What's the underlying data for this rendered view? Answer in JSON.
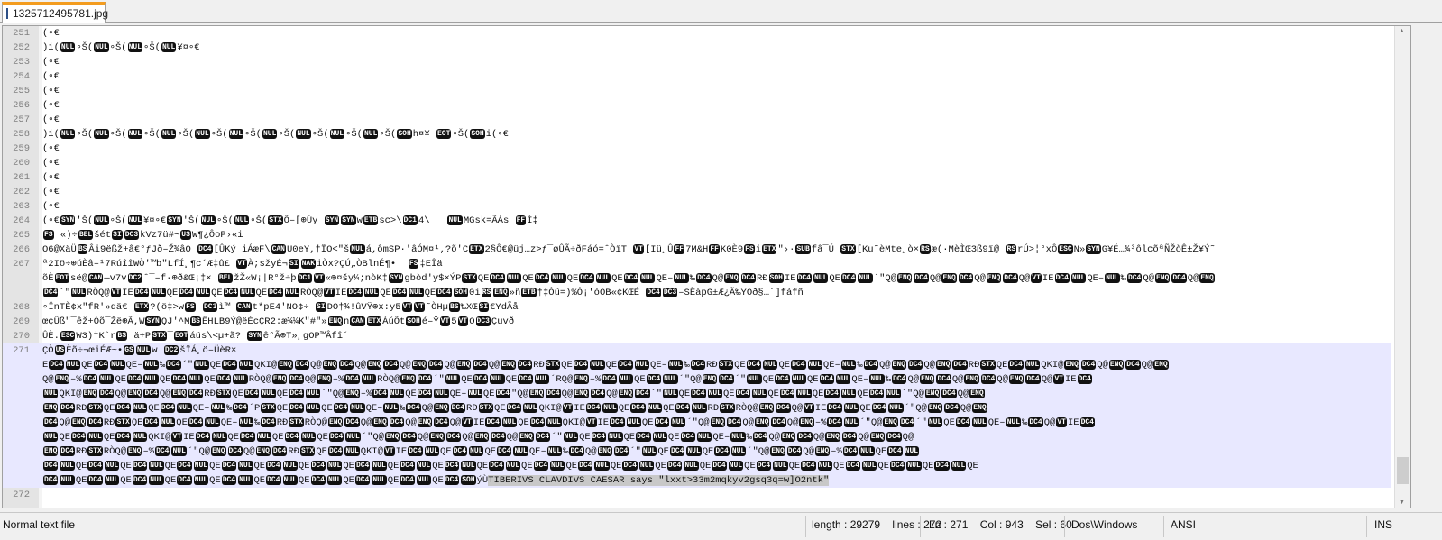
{
  "tab": {
    "filename": "1325712495781.jpg",
    "icon": "save-disk-icon"
  },
  "lines": [
    {
      "num": "251",
      "text": "(∘€"
    },
    {
      "num": "252",
      "text": ")i(«NUL»∘Š(«NUL»∘Š(«NUL»∘Š(«NUL»¥¤∘€"
    },
    {
      "num": "253",
      "text": "(∘€"
    },
    {
      "num": "254",
      "text": "(∘€"
    },
    {
      "num": "255",
      "text": "(∘€"
    },
    {
      "num": "256",
      "text": "(∘€"
    },
    {
      "num": "257",
      "text": "(∘€"
    },
    {
      "num": "258",
      "text": ")i(«NUL»∘Š(«NUL»∘Š(«NUL»∘Š(«NUL»∘Š(«NUL»∘Š(«NUL»∘Š(«NUL»∘Š(«NUL»∘Š(«NUL»∘Š(«NUL»∘Š(«SOH»h¤¥ «EOT»∘Š(«SOH»i(∘€"
    },
    {
      "num": "259",
      "text": "(∘€"
    },
    {
      "num": "260",
      "text": "(∘€"
    },
    {
      "num": "261",
      "text": "(∘€"
    },
    {
      "num": "262",
      "text": "(∘€"
    },
    {
      "num": "263",
      "text": "(∘€"
    },
    {
      "num": "264",
      "text": "(∘€«SYN»'Š(«NUL»∘Š(«NUL»¥¤∘€«SYN»'Š(«NUL»∘Š(«NUL»∘Š(«STX»Õ–[⊕Ùy «SYN»«SYN»w«ETB»sc>\\«DC1»4\\   «NUL»MGsk=ÃÁs «FF»Ì‡"
    },
    {
      "num": "265",
      "text": "«FS» «)÷«BEL»šét«SI»«DC3»kVz7ü#~«US»W¶¿ÔoP›«i"
    },
    {
      "num": "266",
      "text": "O6@XäÜ«BS»Âi9ëßž+â€°ƒJð–Ž¾âO «DC4»[ÛKý iÁæF\\«CAN»U0eY,†ÏO<\"š«NUL»á,ômSP·'âÓM¤¹,?õ'C«ETX»2§Ô€@üj…z>ƒ¯øÛÃ÷ðFáó=ˆÒïT «VT»[Iü¸Û«FF»7M&H«FF»K0È9«FS»i«ETX»\"›·«SUB»fâ¯Ú «STX»[Ku˜èMte¸ò×«RS»æ(·MèÌŒ3ß9ï@ «RS»rÚ>¦°xÔ«ESC»N»«SYN»G¥É…¾³ôlcõªÑŽòÊ±Ž¥Ý˜"
    },
    {
      "num": "267",
      "text": "ª2Iö÷⊕úÈâ–¹7RúîîWÒ'™b\"LfÍ¸¶c´Æ‡û£ «VT»À;sžyÉ¬«SI»«NAK»iÒx?ÇÚ„ÒBlnÉ¶•  «FS»‡EÎä\nõÈ«EOT»së@«CAN»—v7v«DC2»ˆ¯–f·⊕ð&Œ¡‡× «BEL»žŽ«W¡|R°ž÷þ«DC1»«VT»«⊕¤šy¼;nòK‡«SYN»gbòd'y$×ÝP«STX»QE«DC4»«NUL»QE«DC4»«NUL»QE«DC4»«NUL»QE«DC4»«NUL»QE–«NUL»‰«DC4»Q@«ENQ»«DC4»RÐ«SOH»IE«DC4»«NUL»QE«DC4»«NUL»´\"Q@«ENQ»«DC4»Q@«ENQ»«DC4»Q@«ENQ»«DC4»Q@«VT»IE«DC4»«NUL»QE–«NUL»‰«DC4»Q@«ENQ»«DC4»Q@«ENQ»\n«DC4»´\"«NUL»RÒQ@«VT»IE«DC4»«NUL»QE«DC4»«NUL»QE«DC4»«NUL»QE«DC4»«NUL»RÒQ@«VT»IE«DC4»«NUL»QE«DC4»«NUL»QE«DC4»«SOH»0i«RS»«ENQ»»ñ«ETB»†‡Ôü=)%Ô¡'óOB«¢KŒÉ «DC4»«DC3»–SÈàpG±Æ¿Ã‰ŸOð§…´]fáfñ"
    },
    {
      "num": "268",
      "text": "∘ÎnTÈ¢x\"fR'»dä€ «ETX»?(ö‡>w«FS» «DC3»ì™ «CAN»t*pE4'NO¢÷ «SI»DO†¾!ûVŸ⊕x:y5«VT»«VT»˜ÒHµ«BS»‰XŒ«SI»€YdÃå"
    },
    {
      "num": "269",
      "text": "œçÛß\"¯êž+Òõ¯Žë⊕Ã,W«SYN»QJ'^M«BS»ÊHLB9Ý@ëÉcÇR2:æ¾¼K\"#\"»«ENQ»n«CAN»«ETX»ÁúÕt«SOH»é–Ÿ«VT»5«VT»O«DC3»Çuvð"
    },
    {
      "num": "270",
      "text": "ÛÈ.«ESC»W3)†K`r«BS» ä+P«STX»¯«EOT»áüs\\<µ+ã? «SYN»ê°Ã⊕T»¸gOP™Âfî´"
    },
    {
      "num": "271",
      "current": true,
      "text": "ÇÒ«US»Èõ÷¬œiÉÆ~•«GS»«NUL»w «DC2»šÏÁ¸ö–ÜèR×\nE«DC4»«NUL»QE«DC4»«NUL»QE–«NUL»‰«DC4»´\"«NUL»QE«DC4»«NUL»QKI@«ENQ»«DC4»Q@«ENQ»«DC4»Q@«ENQ»«DC4»Q@«ENQ»«DC4»Q@«ENQ»«DC4»Q@«ENQ»«DC4»RÐ«STX»QE«DC4»«NUL»QE«DC4»«NUL»QE–«NUL»‰«DC4»RÐ«STX»QE«DC4»«NUL»QE«DC4»«NUL»QE–«NUL»‰«DC4»Q@«ENQ»«DC4»Q@«ENQ»«DC4»RÐ«STX»QE«DC4»«NUL»QKI@«ENQ»«DC4»Q@«ENQ»«DC4»Q@«ENQ»\nQ@«ENQ»–%«DC4»«NUL»QE«DC4»«NUL»QE«DC4»«NUL»QE«DC4»«NUL»RÒQ@«ENQ»«DC4»Q@«ENQ»–%«DC4»«NUL»RÒQ@«ENQ»«DC4»´\"«NUL»QE«DC4»«NUL»QE«DC4»«NUL»´RQ@«ENQ»–%«DC4»«NUL»QE«DC4»«NUL»´\"Q@«ENQ»«DC4»´\"«NUL»QE«DC4»«NUL»QE«DC4»«NUL»QE–«NUL»‰«DC4»Q@«ENQ»«DC4»Q@«ENQ»«DC4»Q@«ENQ»«DC4»Q@«VT»IE«DC4»\n«NUL»QKI@«ENQ»«DC4»Q@«ENQ»«DC4»Q@«ENQ»«DC4»RÐ«STX»QE«DC4»«NUL»QE«DC4»«NUL»´\"Q@«ENQ»–%«DC4»«NUL»QE«DC4»«NUL»QE–«NUL»QE«DC4»\"Q@«ENQ»«DC4»Q@«ENQ»«DC4»Q@«ENQ»«DC4»´\"«NUL»QE«DC4»«NUL»QE«DC4»«NUL»QE«DC4»«NUL»QE«DC4»«NUL»QE«DC4»«NUL»´\"Q@«ENQ»«DC4»Q@«ENQ»\n«ENQ»«DC4»RÐ«STX»QE«DC4»«NUL»QE«DC4»«NUL»QE–«NUL»‰«DC4»´P«STX»QE«DC4»«NUL»QE«DC4»«NUL»QE–«NUL»‰«DC4»Q@«ENQ»«DC4»RÐ«STX»QE«DC4»«NUL»QKI@«VT»IE«DC4»«NUL»QE«DC4»«NUL»QE«DC4»«NUL»RÐ«STX»RÒQ@«ENQ»«DC4»Q@«VT»IE«DC4»«NUL»QE«DC4»«NUL»´\"Q@«ENQ»«DC4»Q@«ENQ»\n«DC4»Q@«ENQ»«DC4»RÐ«STX»QE«DC4»«NUL»QE«DC4»«NUL»QE–«NUL»‰«DC4»RÐ«STX»RÒQ@«ENQ»«DC4»Q@«ENQ»«DC4»Q@«ENQ»«DC4»Q@«VT»IE«DC4»«NUL»QE«DC4»«NUL»QKI@«VT»IE«DC4»«NUL»QE«DC4»«NUL»´\"Q@«ENQ»«DC4»Q@«ENQ»«DC4»Q@«ENQ»–%«DC4»«NUL»´\"Q@«ENQ»«DC4»´\"«NUL»QE«DC4»«NUL»QE–«NUL»‰«DC4»Q@«VT»IE«DC4»\n«NUL»QE«DC4»«NUL»QE«DC4»«NUL»QKI@«VT»IE«DC4»«NUL»QE«DC4»«NUL»QE«DC4»«NUL»QE«DC4»«NUL»´\"Q@«ENQ»«DC4»Q@«ENQ»«DC4»Q@«ENQ»«DC4»Q@«ENQ»«DC4»´\"«NUL»QE«DC4»«NUL»QE«DC4»«NUL»QE«DC4»«NUL»QE–«NUL»‰«DC4»Q@«ENQ»«DC4»Q@«ENQ»«DC4»Q@«ENQ»«DC4»Q@\n«ENQ»«DC4»RÐ«STX»RÒQ@«ENQ»–%«DC4»«NUL»´\"Q@«ENQ»«DC4»Q@«ENQ»«DC4»RÐ«STX»QE«DC4»«NUL»QKI@«VT»IE«DC4»«NUL»QE«DC4»«NUL»QE«DC4»«NUL»QE–«NUL»‰«DC4»Q@«ENQ»«DC4»´\"«NUL»QE«DC4»«NUL»QE«DC4»«NUL»´\"Q@«ENQ»«DC4»Q@«ENQ»–%«DC4»«NUL»QE«DC4»«NUL»\n«DC4»«NUL»QE«DC4»«NUL»QE«DC4»«NUL»QE«DC4»«NUL»QE«DC4»«NUL»QE«DC4»«NUL»QE«DC4»«NUL»QE«DC4»«NUL»QE«DC4»«NUL»QE«DC4»«NUL»QE«DC4»«NUL»QE«DC4»«NUL»QE«DC4»«NUL»QE«DC4»«NUL»QE«DC4»«NUL»QE«DC4»«NUL»QE«DC4»«NUL»QE«DC4»«NUL»QE«DC4»«NUL»QE«DC4»«NUL»QE«DC4»«NUL»QE\n«DC4»«NUL»QE«DC4»«NUL»QE«DC4»«NUL»QE«DC4»«NUL»QE«DC4»«NUL»QE«DC4»«NUL»QE«DC4»«NUL»QE«DC4»«NUL»QE«DC4»«NUL»QE«DC4»«SOH»ýÙ",
      "selected": "TIBERIVS CLAVDIVS CAESAR says \"lxxt>33m2mqkyv2gsq3q=w]O2ntk\""
    },
    {
      "num": "272",
      "text": ""
    }
  ],
  "status": {
    "file_type": "Normal text file",
    "length": "length : 29279    lines : 272",
    "position": "Ln : 271    Col : 943    Sel : 60",
    "eol": "Dos\\Windows",
    "encoding": "ANSI",
    "mode": "INS"
  }
}
